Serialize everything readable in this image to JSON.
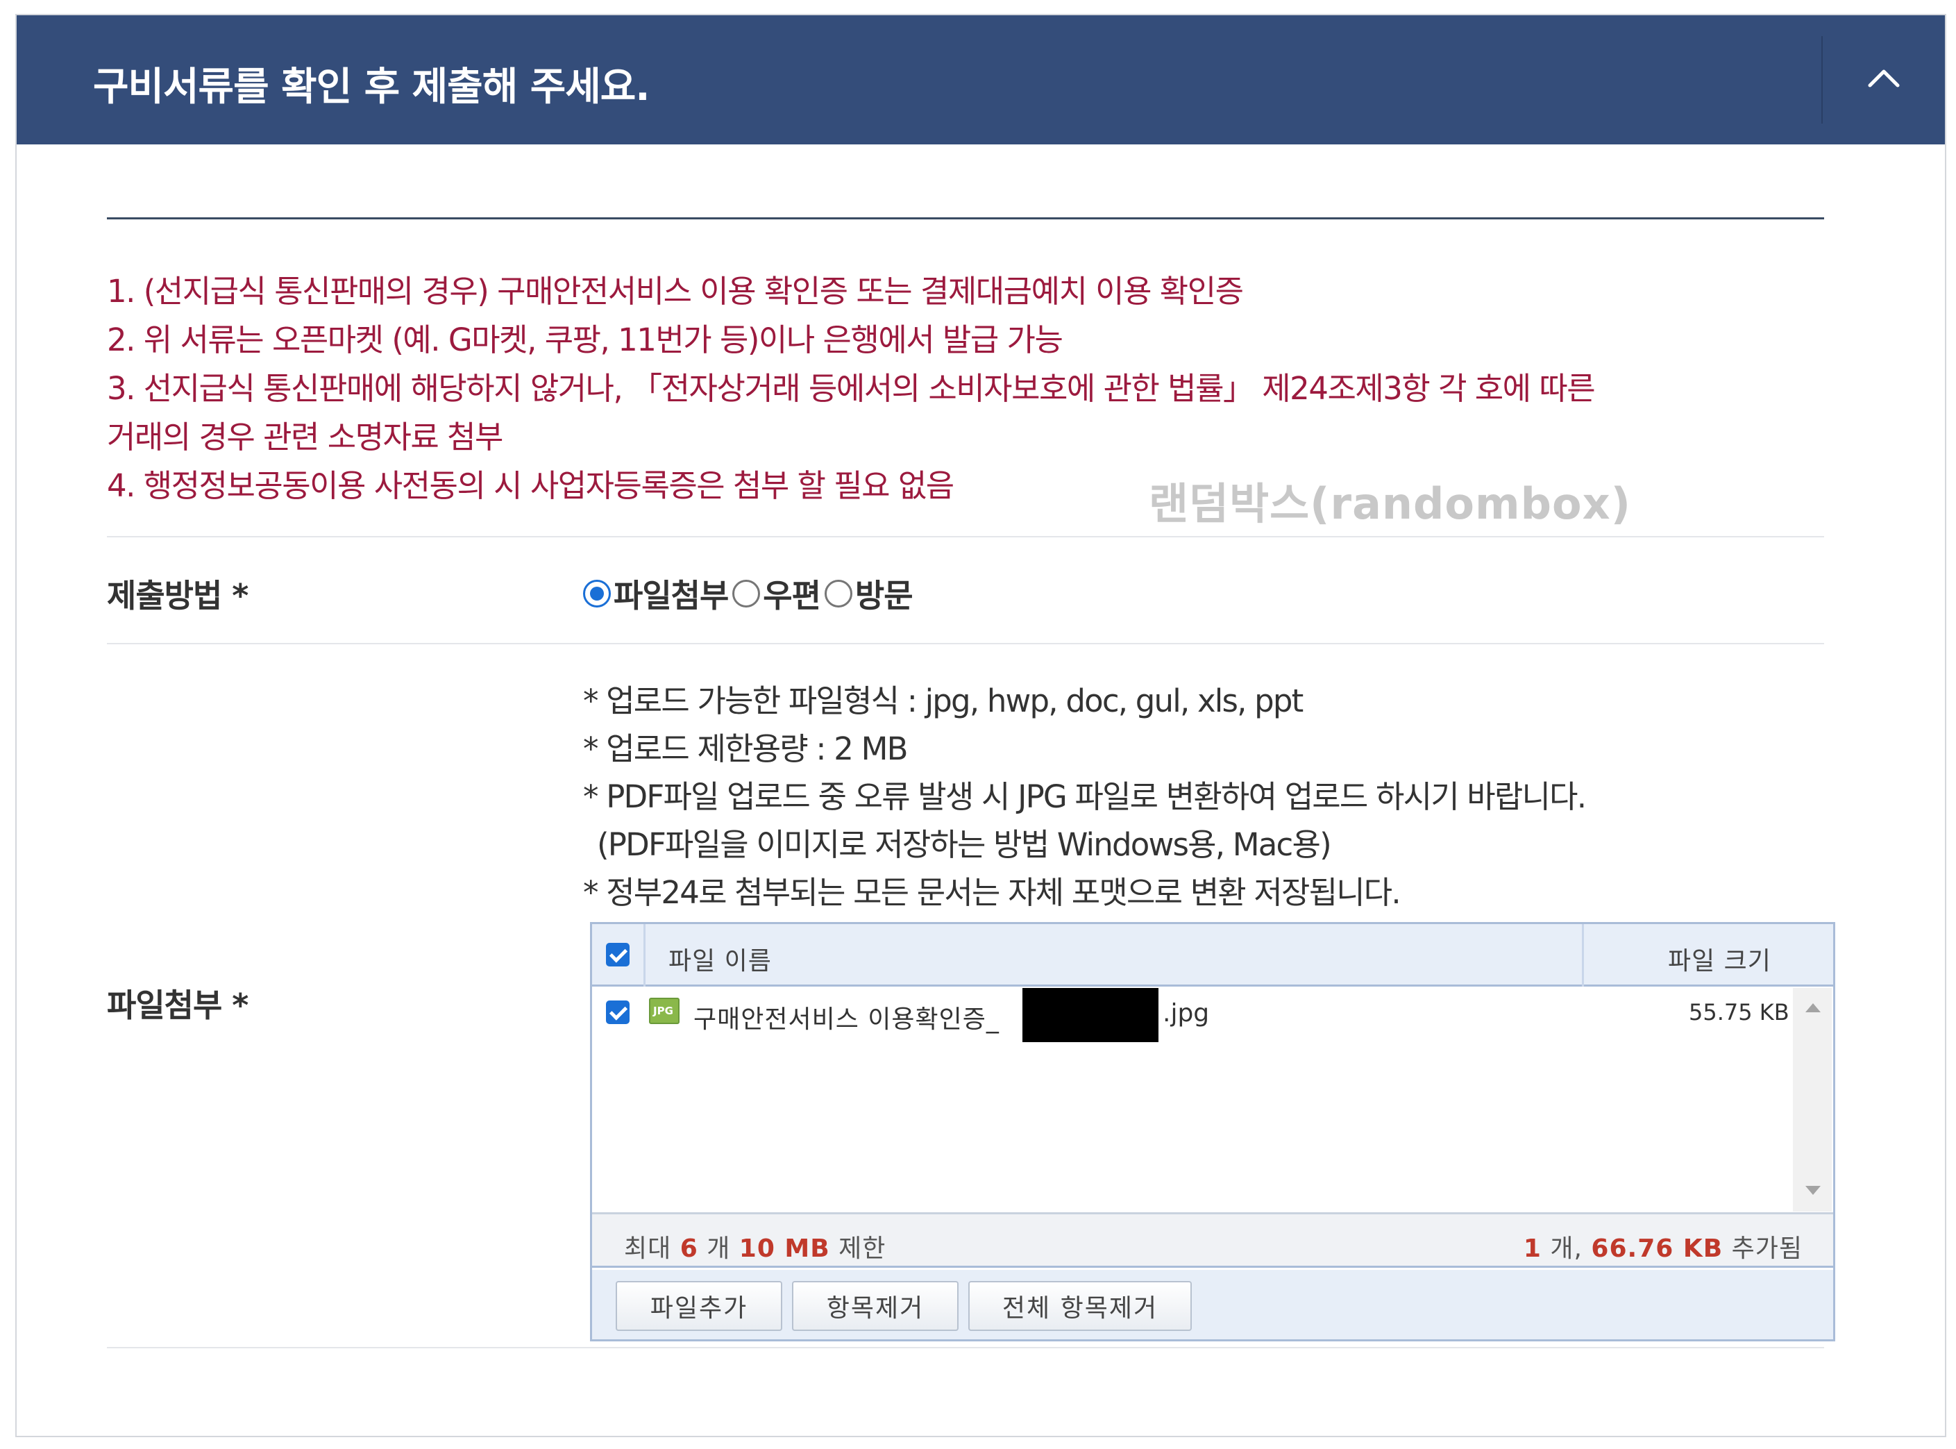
{
  "header": {
    "title": "구비서류를 확인 후 제출해 주세요.",
    "collapse_icon": "chevron-up-icon"
  },
  "notices": [
    "1. (선지급식 통신판매의 경우) 구매안전서비스 이용 확인증 또는 결제대금예치 이용 확인증",
    "2. 위 서류는 오픈마켓 (예. G마켓, 쿠팡, 11번가 등)이나 은행에서 발급 가능",
    "3. 선지급식 통신판매에 해당하지 않거나, 「전자상거래 등에서의 소비자보호에 관한 법률」 제24조제3항 각 호에 따른",
    "거래의 경우 관련 소명자료 첨부",
    "4. 행정정보공동이용 사전동의 시 사업자등록증은 첨부 할 필요 없음"
  ],
  "watermark": "랜덤박스(randombox)",
  "submit_method": {
    "label": "제출방법 *",
    "options": [
      "파일첨부",
      "우편",
      "방문"
    ],
    "selected": "파일첨부"
  },
  "attachment": {
    "label": "파일첨부 *",
    "guides": [
      "* 업로드 가능한 파일형식 : jpg, hwp, doc, gul, xls, ppt",
      "* 업로드 제한용량 : 2 MB",
      "* PDF파일 업로드 중 오류 발생 시 JPG 파일로 변환하여 업로드 하시기 바랍니다.",
      "  (PDF파일을 이미지로 저장하는 방법  Windows용, Mac용)",
      "* 정부24로 첨부되는 모든 문서는 자체 포맷으로 변환 저장됩니다."
    ],
    "table": {
      "header_name": "파일 이름",
      "header_size": "파일 크기",
      "files": [
        {
          "name_prefix": "구매안전서비스 이용확인증_",
          "name_suffix": ".jpg",
          "size": "55.75 KB",
          "type_badge": "JPG",
          "checked": true
        }
      ]
    },
    "status": {
      "limit_prefix": "최대",
      "limit_count": "6",
      "limit_count_unit": "개",
      "limit_size": "10 MB",
      "limit_suffix": "제한",
      "added_count": "1",
      "added_count_unit": "개,",
      "added_size": "66.76 KB",
      "added_suffix": "추가됨"
    },
    "buttons": {
      "add": "파일추가",
      "remove": "항목제거",
      "remove_all": "전체 항목제거"
    }
  },
  "colors": {
    "header_bg": "#344d7a",
    "notice_text": "#9c1a3e",
    "accent_blue": "#1a6fd6",
    "status_highlight": "#c0392b"
  }
}
